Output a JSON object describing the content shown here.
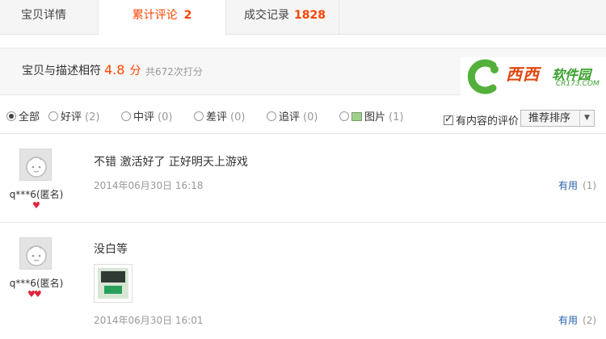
{
  "tabs": [
    {
      "label": "宝贝详情",
      "count": ""
    },
    {
      "label": "累计评论",
      "count": "2"
    },
    {
      "label": "成交记录",
      "count": "1828"
    }
  ],
  "rating": {
    "label": "宝贝与描述相符",
    "score": "4.8",
    "unit": "分",
    "total": "共672次打分"
  },
  "logo": {
    "text": "西西",
    "text2": "软件园",
    "subtext": "CR173.COM"
  },
  "filters": [
    {
      "label": "全部",
      "count": "",
      "selected": true
    },
    {
      "label": "好评",
      "count": "(2)",
      "selected": false
    },
    {
      "label": "中评",
      "count": "(0)",
      "selected": false
    },
    {
      "label": "差评",
      "count": "(0)",
      "selected": false
    },
    {
      "label": "追评",
      "count": "(0)",
      "selected": false
    },
    {
      "label": "图片",
      "count": "(1)",
      "selected": false
    }
  ],
  "content_only": {
    "label": "有内容的评价",
    "checked": true
  },
  "sort": {
    "value": "推荐排序"
  },
  "reviews": [
    {
      "user": "q***6(匿名)",
      "badge": "♥",
      "text": "不错 激活好了 正好明天上游戏",
      "date": "2014年06月30日 16:18",
      "useful_label": "有用",
      "useful_count": "(1)"
    },
    {
      "user": "q***6(匿名)",
      "badge": "♥♥",
      "text": "没白等",
      "date": "2014年06月30日 16:01",
      "useful_label": "有用",
      "useful_count": "(2)"
    }
  ],
  "colors": {
    "accent": "#ff4400",
    "link": "#2a62b0",
    "muted": "#999999"
  }
}
